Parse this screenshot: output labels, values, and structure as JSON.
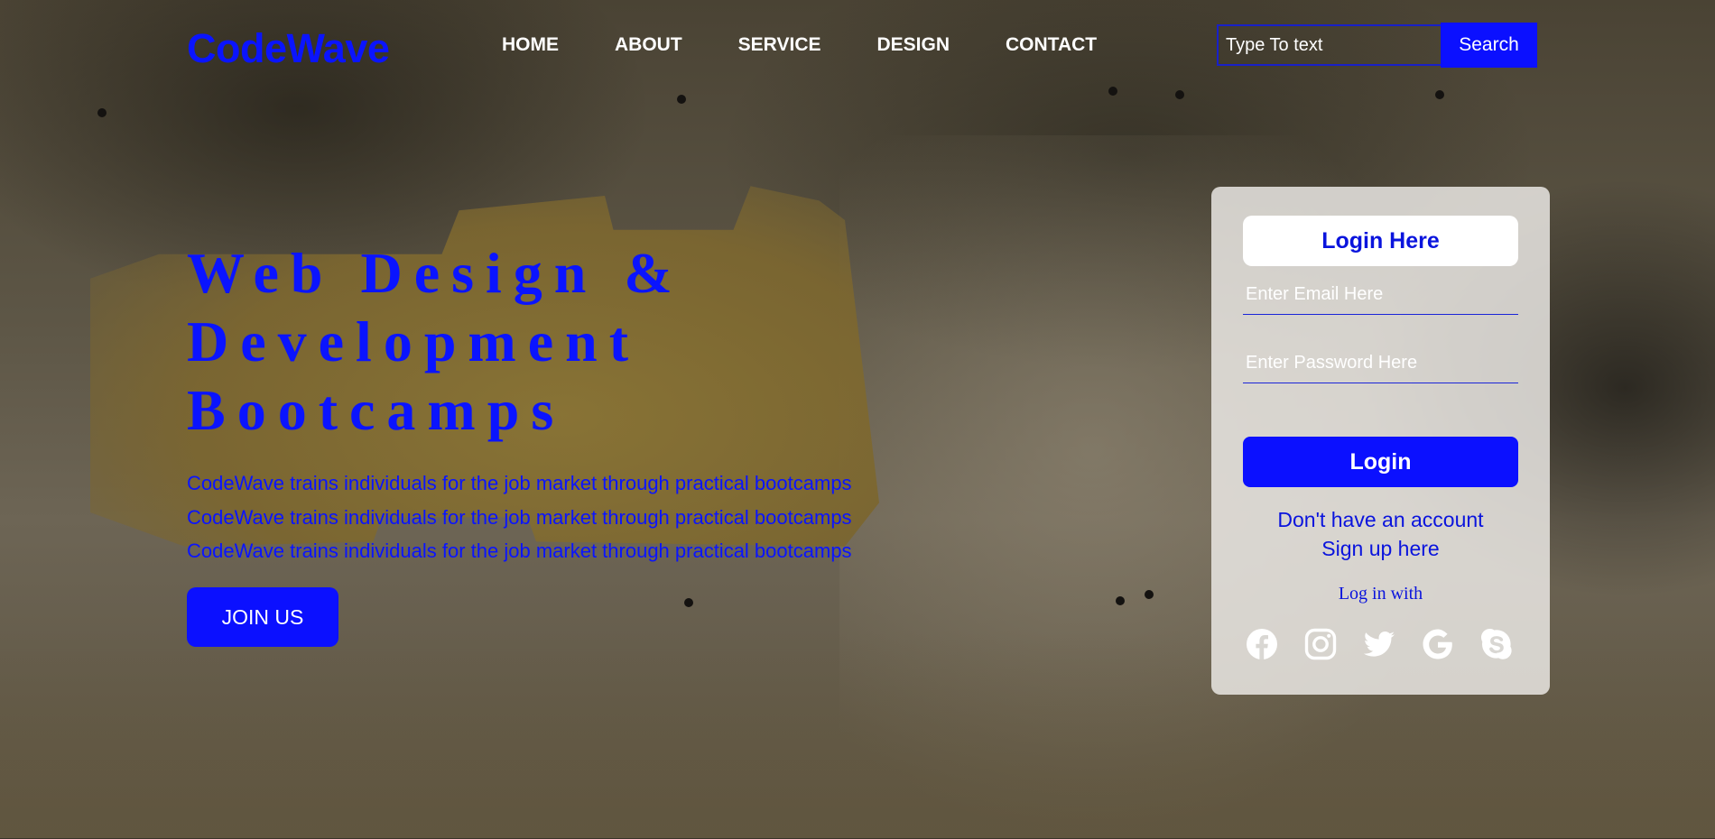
{
  "brand": {
    "logo": "CodeWave"
  },
  "nav": {
    "items": [
      "HOME",
      "ABOUT",
      "SERVICE",
      "DESIGN",
      "CONTACT"
    ]
  },
  "search": {
    "placeholder": "Type To text",
    "button_label": "Search"
  },
  "hero": {
    "title_lines": [
      "Web Design &",
      "Development",
      "Bootcamps"
    ],
    "paragraph_lines": [
      "CodeWave trains individuals for the job market through practical bootcamps",
      "CodeWave trains individuals for the job market through practical bootcamps",
      "CodeWave trains individuals for the job market through practical bootcamps"
    ],
    "cta_label": "JOIN US"
  },
  "login": {
    "title": "Login Here",
    "email_placeholder": "Enter Email Here",
    "password_placeholder": "Enter Password Here",
    "button_label": "Login",
    "no_account_text": "Don't have an account",
    "signup_link": "Sign up here",
    "log_in_with": "Log in with",
    "social_icons": [
      "facebook-icon",
      "instagram-icon",
      "twitter-icon",
      "google-icon",
      "skype-icon"
    ]
  },
  "colors": {
    "accent": "#0b10ff",
    "text_blue": "#0a14ff",
    "card_bg": "#eceae6"
  }
}
